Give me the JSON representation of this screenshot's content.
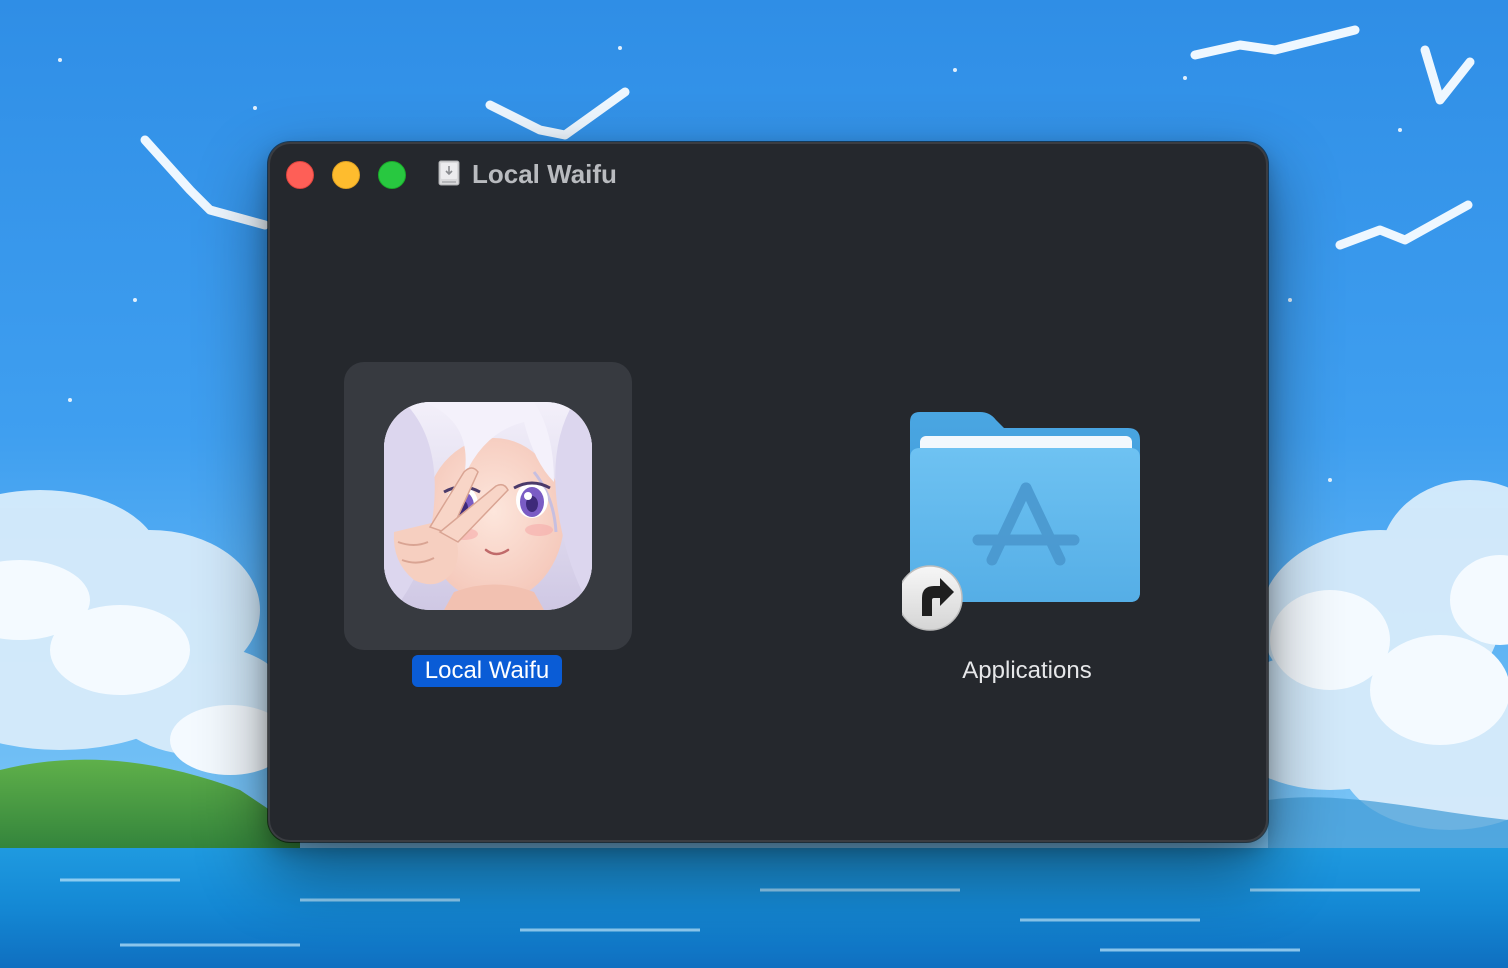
{
  "window": {
    "title": "Local Waifu"
  },
  "items": {
    "app": {
      "label": "Local Waifu",
      "selected": true
    },
    "applications": {
      "label": "Applications"
    }
  },
  "icons": {
    "title_bar": "disk-image-icon",
    "app": "local-waifu-app-icon",
    "applications": "applications-folder-icon",
    "alias_badge": "alias-arrow-icon"
  },
  "colors": {
    "window_background": "#25282d",
    "selection_background": "#373a40",
    "label_highlight": "#0a5cd6",
    "close": "#fe5f57",
    "minimize": "#febc2e",
    "zoom": "#28c840",
    "folder": "#5aaee6"
  }
}
